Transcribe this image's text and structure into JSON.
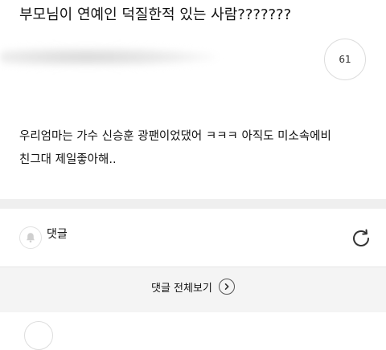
{
  "post": {
    "title": "부모님이 연예인 덕질한적 있는 사람???????",
    "comment_count": "61",
    "body_lines": [
      "우리엄마는 가수 신승훈 광팬이었댔어 ㅋㅋㅋ 아직도 미소속에비",
      "친그대 제일좋아해.."
    ]
  },
  "comments": {
    "label": "댓글",
    "view_all_label": "댓글 전체보기"
  },
  "icons": {
    "bell": "bell-icon",
    "refresh": "refresh-icon",
    "chevron": "chevron-right-icon"
  },
  "colors": {
    "divider_band": "#efefef",
    "view_all_bg": "#f4f4f4"
  }
}
